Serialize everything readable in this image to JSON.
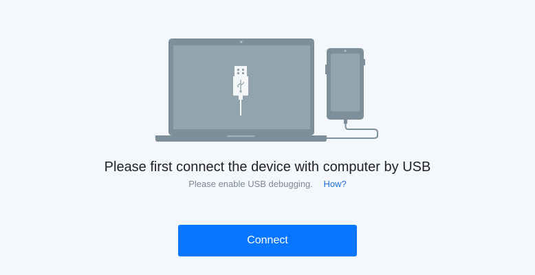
{
  "message": {
    "title": "Please first connect the device with computer by USB",
    "hint": "Please enable USB debugging.",
    "help_link": "How?"
  },
  "actions": {
    "connect_label": "Connect"
  },
  "colors": {
    "background": "#f4f8fc",
    "device_frame": "#7d8f99",
    "device_screen": "#92a5ae",
    "accent": "#0876ff",
    "link": "#1a6fd6"
  },
  "icons": [
    "laptop-icon",
    "phone-icon",
    "usb-plug-icon",
    "usb-cable-icon"
  ]
}
